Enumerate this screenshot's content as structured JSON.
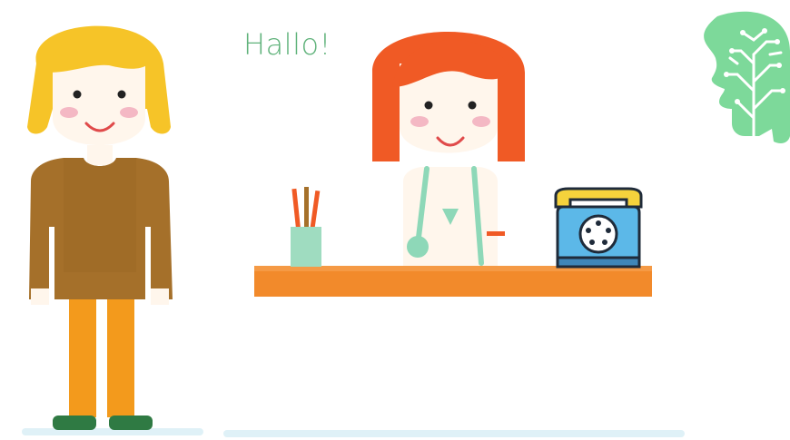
{
  "greeting": "Hallo!",
  "colors": {
    "greeting_text": "#5fb27a",
    "patient_hair": "#f6c428",
    "patient_sweater": "#a5702a",
    "patient_pants": "#f39a1c",
    "patient_shoes": "#2f7a43",
    "doctor_hair": "#f05a25",
    "desk": "#f28a2b",
    "stethoscope": "#8ed8b8",
    "pencil_cup": "#9fdcc0",
    "phone_body": "#5cb8e8",
    "phone_handset": "#f5d23c",
    "ai_head": "#7dd99a",
    "skin": "#fff6ec",
    "cheeks": "#f4b8c4",
    "floor": "#dff1f7"
  },
  "icons": [
    "patient-figure",
    "doctor-figure",
    "reception-desk",
    "pencil-cup-icon",
    "telephone-icon",
    "ai-brain-head-icon"
  ]
}
